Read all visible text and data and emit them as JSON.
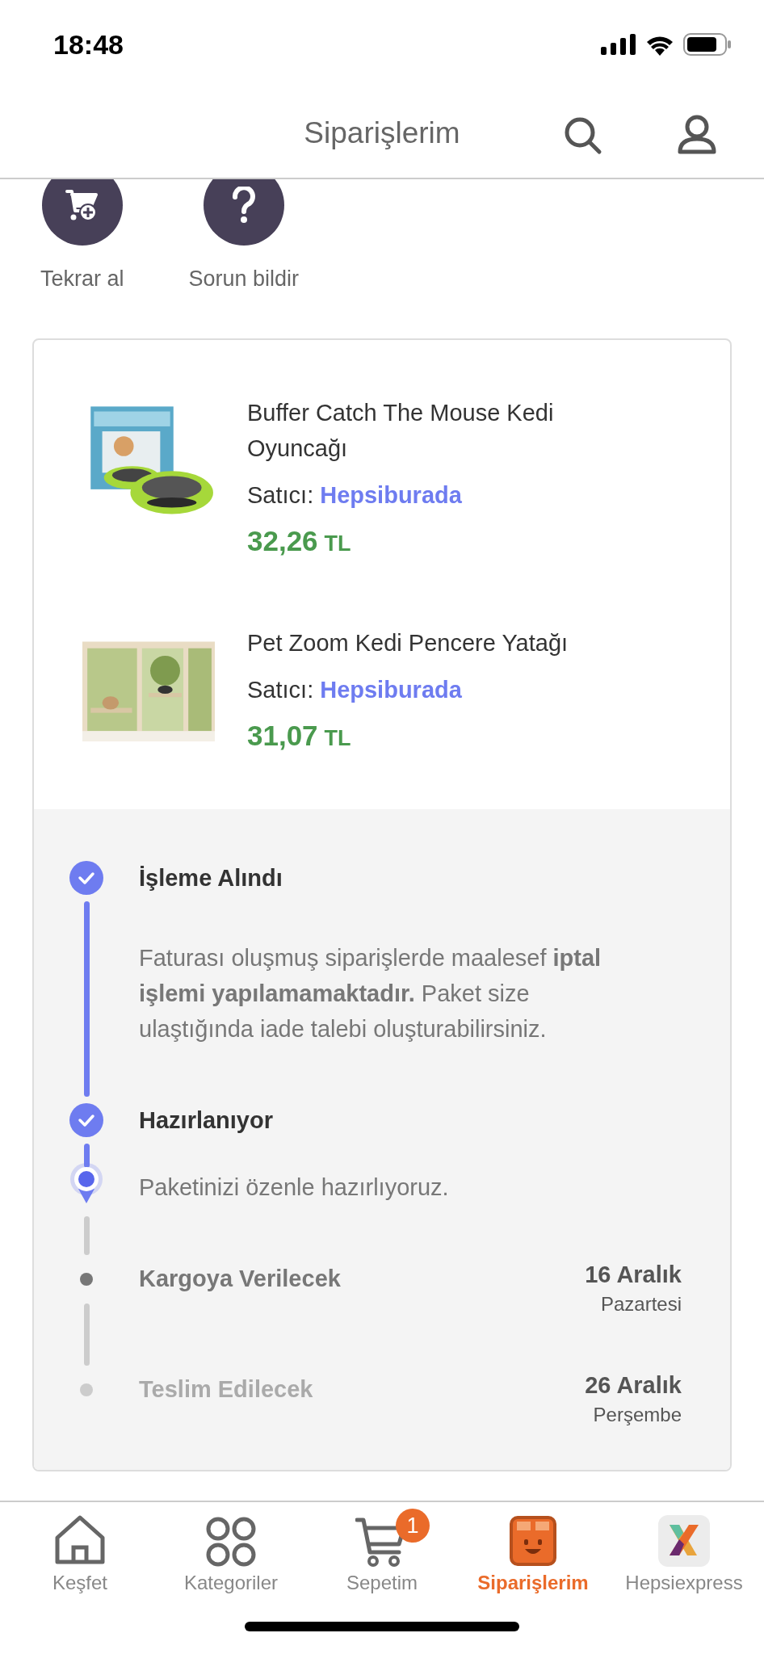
{
  "status_bar": {
    "time": "18:48"
  },
  "header": {
    "title": "Siparişlerim"
  },
  "actions": [
    {
      "label": "Tekrar al",
      "kind": "reorder"
    },
    {
      "label": "Sorun bildir",
      "kind": "help"
    }
  ],
  "products": [
    {
      "name": "Buffer Catch The Mouse Kedi Oyuncağı",
      "seller_label": "Satıcı:",
      "seller": "Hepsiburada",
      "price": "32,26",
      "currency": "TL"
    },
    {
      "name": "Pet Zoom Kedi Pencere Yatağı",
      "seller_label": "Satıcı:",
      "seller": "Hepsiburada",
      "price": "31,07",
      "currency": "TL"
    }
  ],
  "timeline": [
    {
      "title": "İşleme Alındı",
      "kind": "done",
      "note": {
        "text": "Faturası oluşmuş siparişlerde maalesef **iptal işlemi yapılamamaktadır.** Paket size ulaştığında iade talebi oluşturabilirsiniz."
      }
    },
    {
      "title": "Hazırlanıyor",
      "kind": "done",
      "note": {
        "text": "Paketinizi özenle hazırlıyoruz."
      }
    },
    {
      "title": "Kargoya Verilecek",
      "kind": "next",
      "date": "16 Aralık",
      "day": "Pazartesi"
    },
    {
      "title": "Teslim Edilecek",
      "kind": "later",
      "date": "26 Aralık",
      "day": "Perşembe"
    }
  ],
  "tabs": [
    {
      "label": "Keşfet",
      "selected": false
    },
    {
      "label": "Kategoriler",
      "selected": false
    },
    {
      "label": "Sepetim",
      "badge": "1",
      "selected": false
    },
    {
      "label": "Siparişlerim",
      "selected": true
    },
    {
      "label": "Hepsiexpress",
      "selected": false
    }
  ]
}
